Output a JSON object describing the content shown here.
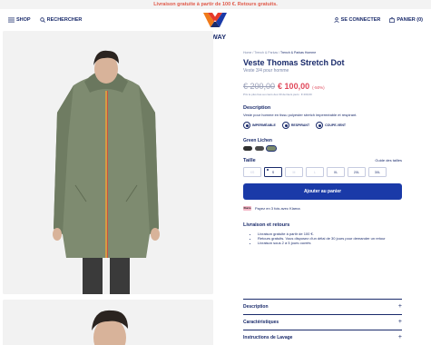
{
  "promo_banner": "Livraison gratuite à partir de 100 €. Retours gratuits.",
  "header": {
    "shop": "SHOP",
    "search": "RECHERCHER",
    "login": "SE CONNECTER",
    "cart": "PANIER (0)",
    "logo_text": "K-WAY"
  },
  "breadcrumb": {
    "home": "Home",
    "category": "Trench & Parkas",
    "current": "Trench & Parkas Homme"
  },
  "product": {
    "title": "Veste Thomas Stretch Dot",
    "subtitle": "Veste 3/4 pour homme",
    "old_price": "€ 200,00",
    "new_price": "€ 100,00",
    "discount": "(-50%)",
    "price_note": "Prix le plus bas au cours des 30 derniers jours : € 200,00"
  },
  "description": {
    "title": "Description",
    "text": "Veste pour homme en tissu polyester stretch imperméable et respirant.",
    "features": [
      {
        "label": "IMPERMÉABLE",
        "icon": "waterproof-icon"
      },
      {
        "label": "RESPIRANT",
        "icon": "breathable-icon"
      },
      {
        "label": "COUPE-VENT",
        "icon": "windproof-icon"
      }
    ]
  },
  "color": {
    "name": "Green Lichen",
    "swatches": [
      "#2f2f2f",
      "#4a4a4a",
      "#7b8a6a"
    ]
  },
  "size": {
    "title": "Taille",
    "guide": "Guide des tailles",
    "options": [
      "XS",
      "S",
      "M",
      "L",
      "XL",
      "2XL",
      "3XL"
    ]
  },
  "add_to_cart": "Ajouter au panier",
  "klarna": {
    "logo": "Klarna",
    "text": "Payez en 3 fois avec Klarna"
  },
  "shipping": {
    "title": "Livraison et retours",
    "items": [
      "Livraison gratuite à partir de 100 €.",
      "Retours gratuits. Vous disposez d'un délai de 30 jours pour demander un retour",
      "Livraison sous 2 à 5 jours ouvrés"
    ]
  },
  "accordions": [
    "Description",
    "Caractéristiques",
    "Instructions de Lavage"
  ]
}
